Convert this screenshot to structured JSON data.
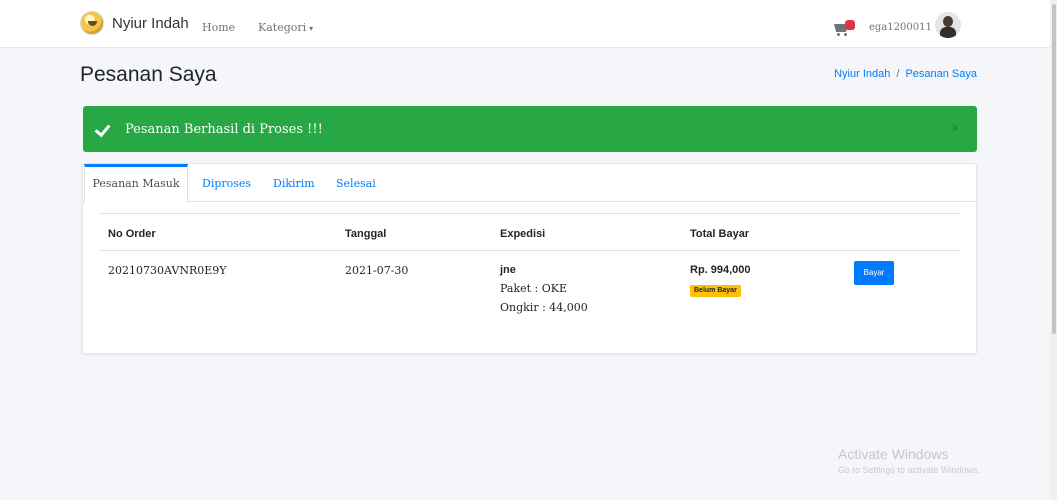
{
  "navbar": {
    "brand_name": "Nyiur Indah",
    "home_label": "Home",
    "kategori_label": "Kategori",
    "caret": "▾",
    "username": "ega1200011"
  },
  "page": {
    "title": "Pesanan Saya",
    "breadcrumb": {
      "link": "Nyiur Indah",
      "separator": "/",
      "active": "Pesanan Saya"
    }
  },
  "alert": {
    "message": "Pesanan Berhasil di Proses !!!",
    "close": "×",
    "color": "#28a745"
  },
  "tabs": [
    {
      "label": "Pesanan Masuk",
      "active": true
    },
    {
      "label": "Diproses",
      "active": false
    },
    {
      "label": "Dikirim",
      "active": false
    },
    {
      "label": "Selesai",
      "active": false
    }
  ],
  "table": {
    "headers": [
      "No Order",
      "Tanggal",
      "Expedisi",
      "Total Bayar"
    ],
    "rows": [
      {
        "no_order": "20210730AVNR0E9Y",
        "tanggal": "2021-07-30",
        "expedisi": "jne",
        "paket": "Paket : OKE",
        "ongkir": "Ongkir : 44,000",
        "total": "Rp. 994,000",
        "status": "Belum Bayar",
        "action": "Bayar"
      }
    ]
  },
  "watermark": {
    "title": "Activate Windows",
    "subtitle": "Go to Settings to activate Windows."
  },
  "colors": {
    "primary": "#007bff",
    "success": "#28a745",
    "warning": "#ffc107",
    "danger": "#dc3545"
  }
}
